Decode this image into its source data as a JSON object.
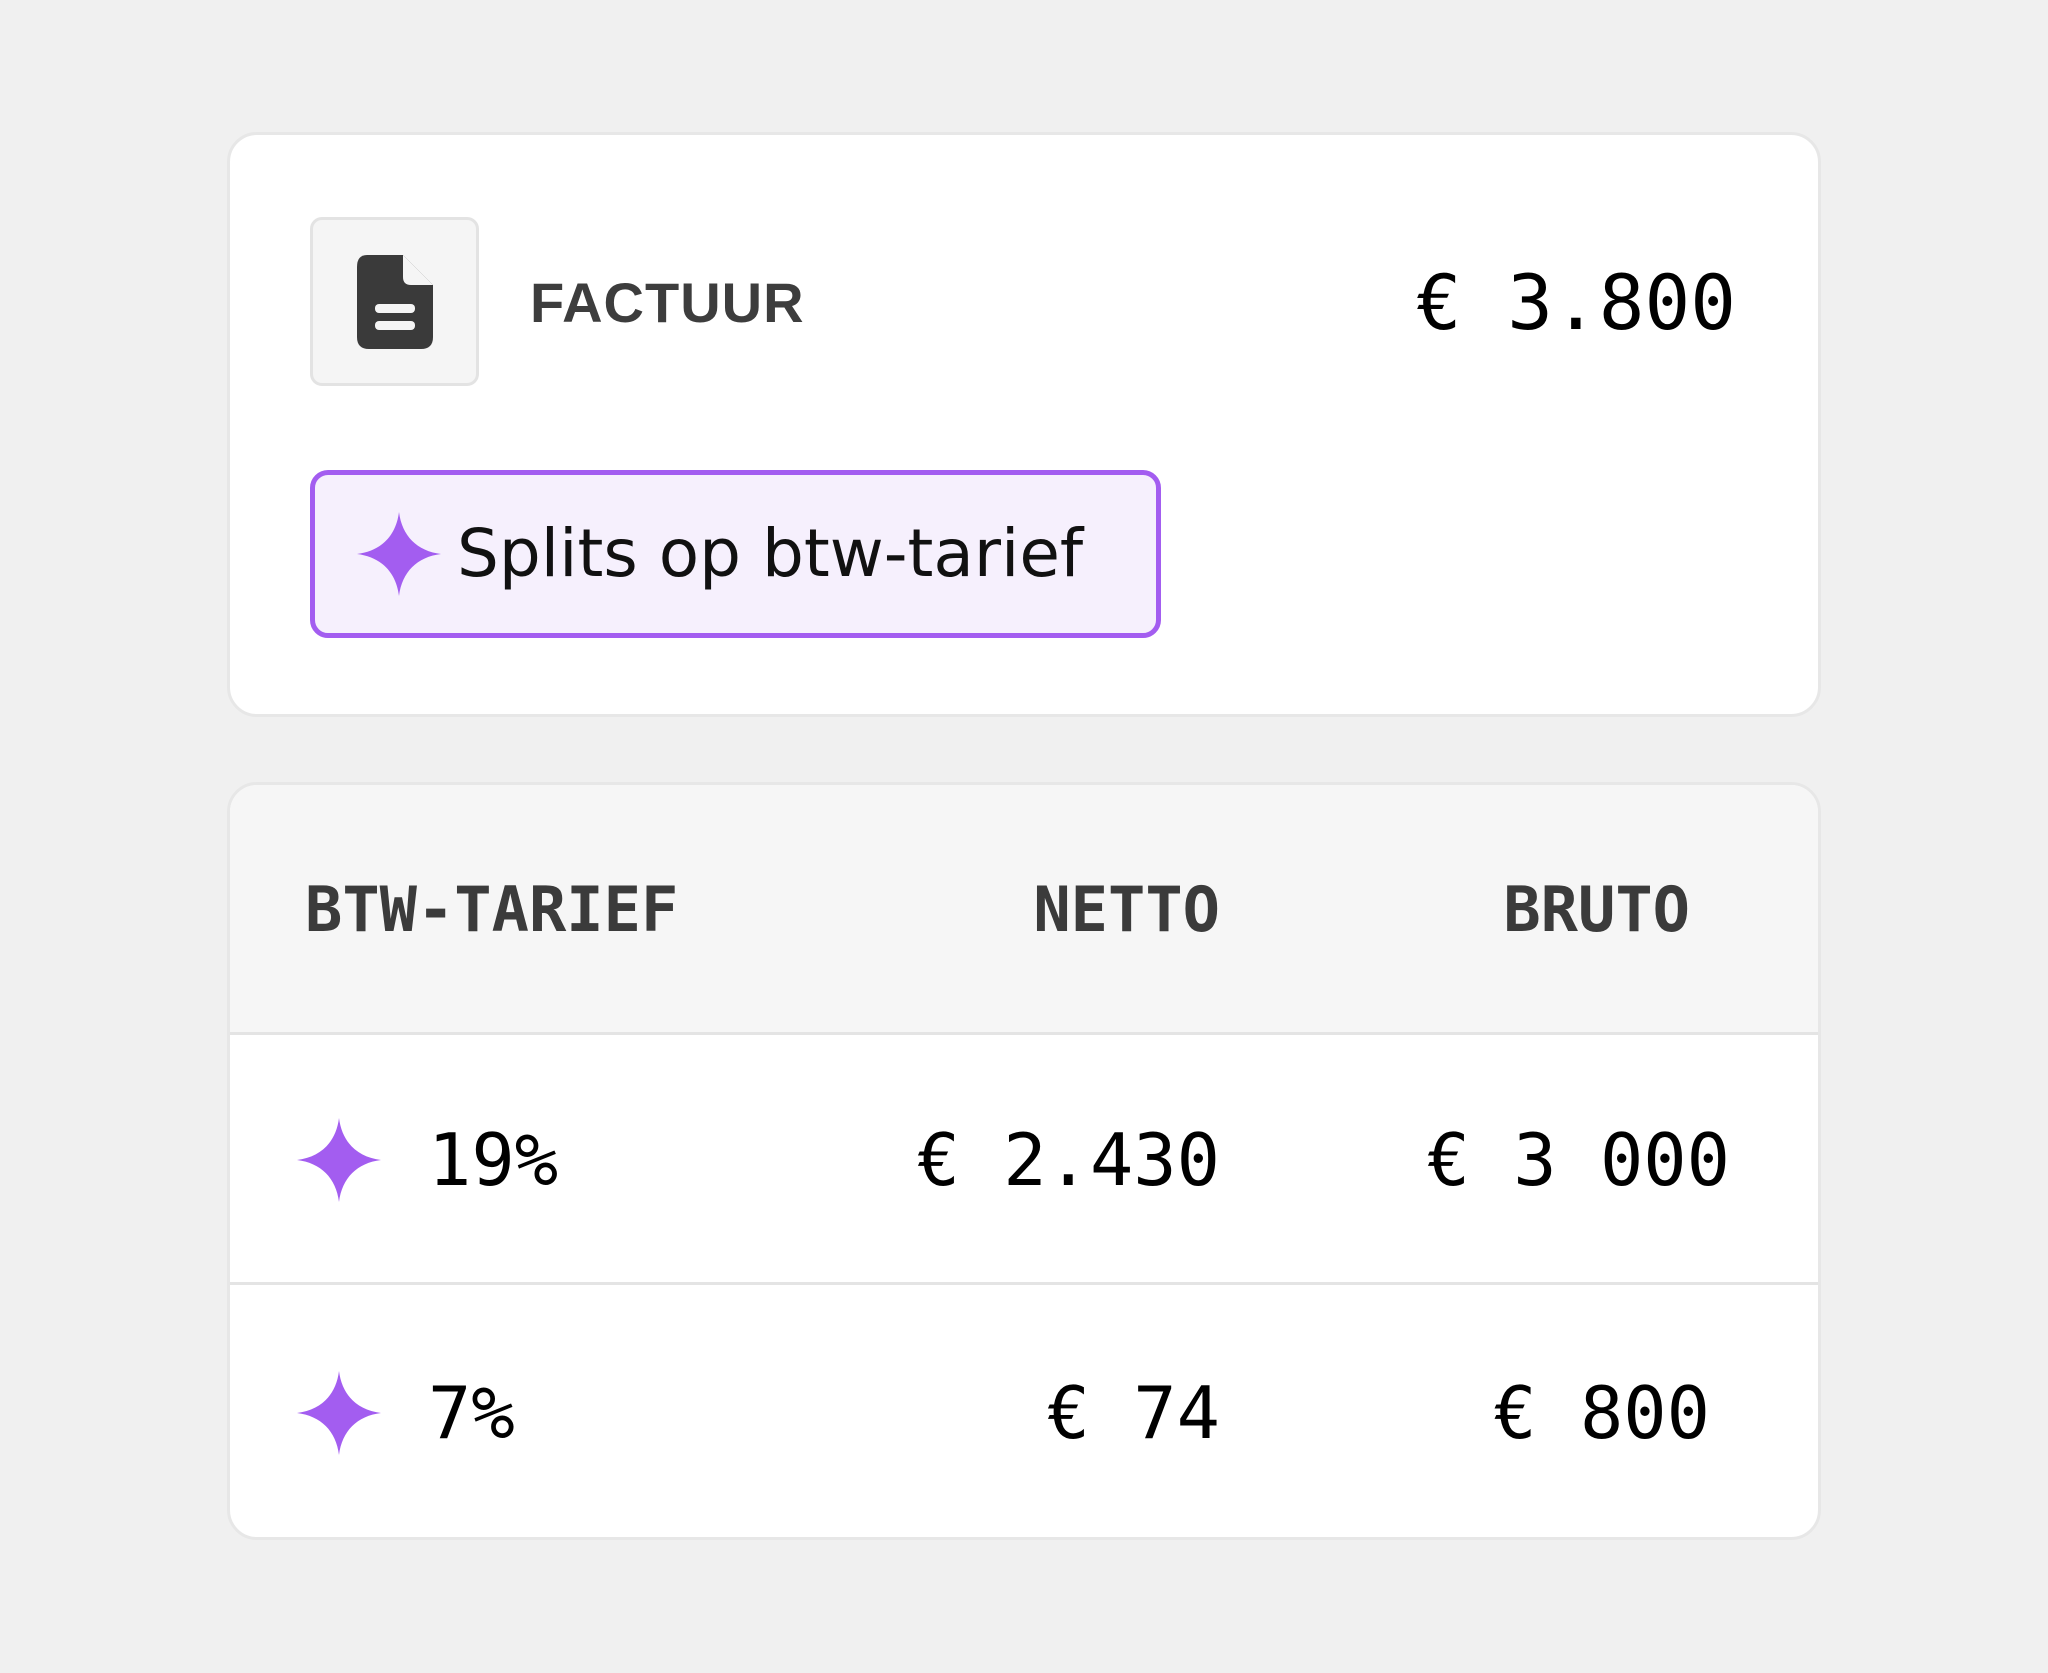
{
  "colors": {
    "background": "#f0f0f0",
    "card": "#ffffff",
    "accent": "#a35df0",
    "accent_fill": "#f6f0fd",
    "header_fill": "#f6f6f6",
    "text_primary": "#000000",
    "text_secondary": "#3b3b3b"
  },
  "invoice": {
    "icon": "document-icon",
    "label": "FACTUUR",
    "amount": "€ 3.800"
  },
  "action": {
    "icon": "sparkle-icon",
    "label": "Splits op btw-tarief"
  },
  "vat_table": {
    "headers": [
      "BTW-TARIEF",
      "NETTO",
      "BRUTO"
    ],
    "rows": [
      {
        "icon": "sparkle-icon",
        "rate": "19%",
        "net": "€ 2.430",
        "gross": "€ 3 000"
      },
      {
        "icon": "sparkle-icon",
        "rate": "7%",
        "net": "€ 74",
        "gross": "€ 800"
      }
    ]
  }
}
